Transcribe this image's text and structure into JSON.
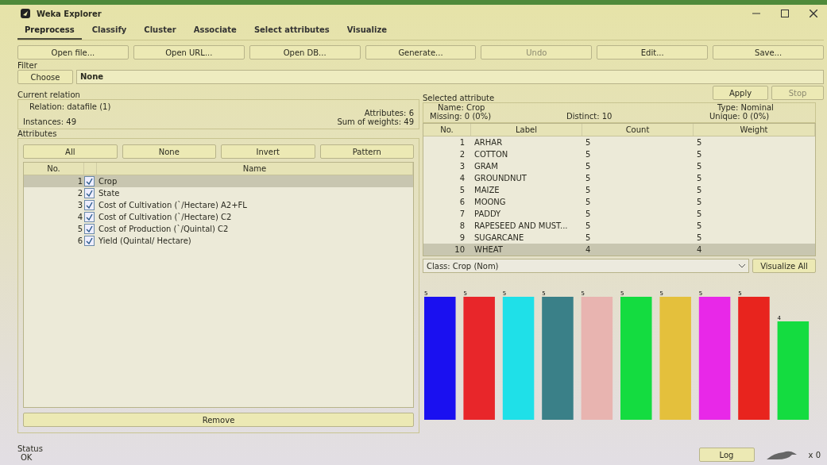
{
  "window": {
    "title": "Weka Explorer"
  },
  "tabs": [
    {
      "label": "Preprocess",
      "selected": true
    },
    {
      "label": "Classify",
      "selected": false
    },
    {
      "label": "Cluster",
      "selected": false
    },
    {
      "label": "Associate",
      "selected": false
    },
    {
      "label": "Select attributes",
      "selected": false
    },
    {
      "label": "Visualize",
      "selected": false
    }
  ],
  "toolbar": [
    {
      "label": "Open file...",
      "disabled": false
    },
    {
      "label": "Open URL...",
      "disabled": false
    },
    {
      "label": "Open DB...",
      "disabled": false
    },
    {
      "label": "Generate...",
      "disabled": false
    },
    {
      "label": "Undo",
      "disabled": true
    },
    {
      "label": "Edit...",
      "disabled": false
    },
    {
      "label": "Save...",
      "disabled": false
    }
  ],
  "filter": {
    "title": "Filter",
    "choose": "Choose",
    "value": "None",
    "apply": {
      "label": "Apply",
      "disabled": false
    },
    "stop": {
      "label": "Stop",
      "disabled": true
    }
  },
  "current_relation": {
    "title": "Current relation",
    "relation": "Relation: datafile (1)",
    "instances": "Instances: 49",
    "attributes": "Attributes: 6",
    "sum_of_weights": "Sum of weights: 49"
  },
  "attributes": {
    "title": "Attributes",
    "buttons": [
      "All",
      "None",
      "Invert",
      "Pattern"
    ],
    "columns": [
      "No.",
      "Name"
    ],
    "rows": [
      {
        "no": "1",
        "name": "Crop",
        "checked": true,
        "selected": true
      },
      {
        "no": "2",
        "name": "State",
        "checked": true,
        "selected": false
      },
      {
        "no": "3",
        "name": "Cost of Cultivation (`/Hectare) A2+FL",
        "checked": true,
        "selected": false
      },
      {
        "no": "4",
        "name": "Cost of Cultivation (`/Hectare) C2",
        "checked": true,
        "selected": false
      },
      {
        "no": "5",
        "name": "Cost of Production (`/Quintal) C2",
        "checked": true,
        "selected": false
      },
      {
        "no": "6",
        "name": "Yield (Quintal/ Hectare)",
        "checked": true,
        "selected": false
      }
    ],
    "remove": "Remove"
  },
  "selected_attribute": {
    "title": "Selected attribute",
    "name": "Name: Crop",
    "missing": "Missing: 0 (0%)",
    "distinct": "Distinct: 10",
    "type": "Type: Nominal",
    "unique": "Unique: 0 (0%)",
    "columns": [
      "No.",
      "Label",
      "Count",
      "Weight"
    ],
    "rows": [
      {
        "no": "1",
        "label": "ARHAR",
        "count": "5",
        "weight": "5",
        "selected": false
      },
      {
        "no": "2",
        "label": "COTTON",
        "count": "5",
        "weight": "5",
        "selected": false
      },
      {
        "no": "3",
        "label": "GRAM",
        "count": "5",
        "weight": "5",
        "selected": false
      },
      {
        "no": "4",
        "label": "GROUNDNUT",
        "count": "5",
        "weight": "5",
        "selected": false
      },
      {
        "no": "5",
        "label": "MAIZE",
        "count": "5",
        "weight": "5",
        "selected": false
      },
      {
        "no": "6",
        "label": "MOONG",
        "count": "5",
        "weight": "5",
        "selected": false
      },
      {
        "no": "7",
        "label": "PADDY",
        "count": "5",
        "weight": "5",
        "selected": false
      },
      {
        "no": "8",
        "label": "RAPESEED AND MUST...",
        "count": "5",
        "weight": "5",
        "selected": false
      },
      {
        "no": "9",
        "label": "SUGARCANE",
        "count": "5",
        "weight": "5",
        "selected": false
      },
      {
        "no": "10",
        "label": "WHEAT",
        "count": "4",
        "weight": "4",
        "selected": true
      }
    ]
  },
  "class_select": {
    "value": "Class: Crop (Nom)",
    "visualize_all": "Visualize All"
  },
  "histogram": {
    "bars": [
      {
        "count": "5",
        "color": "#1a10f0"
      },
      {
        "count": "5",
        "color": "#e8262a"
      },
      {
        "count": "5",
        "color": "#1fe0e8"
      },
      {
        "count": "5",
        "color": "#3a8088"
      },
      {
        "count": "5",
        "color": "#e8b4b0"
      },
      {
        "count": "5",
        "color": "#14dc40"
      },
      {
        "count": "5",
        "color": "#e4c03c"
      },
      {
        "count": "5",
        "color": "#e828e8"
      },
      {
        "count": "5",
        "color": "#e8241e"
      },
      {
        "count": "4",
        "color": "#14dc40"
      }
    ]
  },
  "status": {
    "title": "Status",
    "message": "OK",
    "log": "Log",
    "count": "x 0"
  }
}
